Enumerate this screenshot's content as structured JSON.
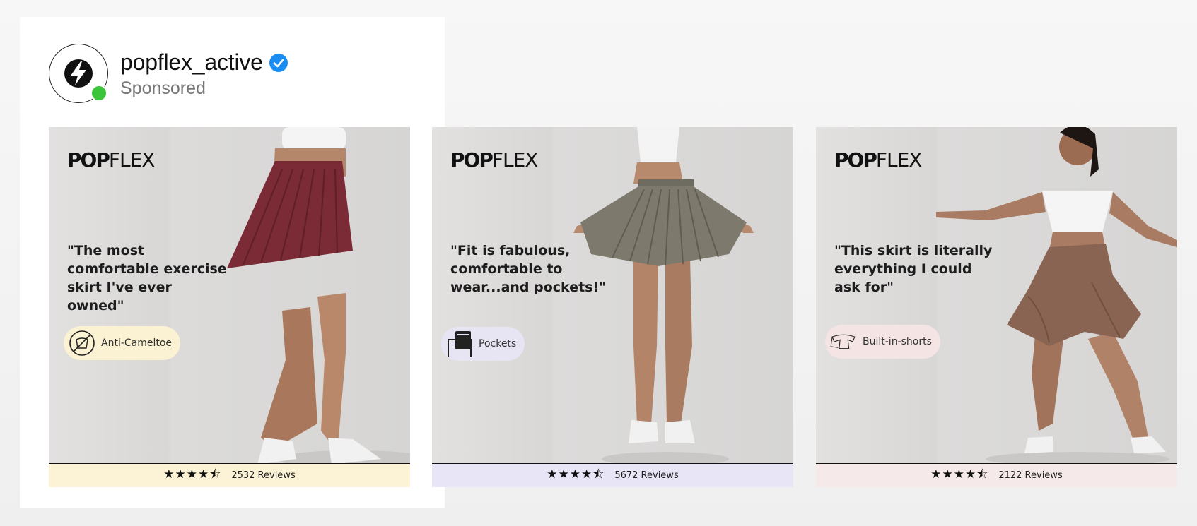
{
  "account": {
    "username": "popflex_active",
    "label": "Sponsored"
  },
  "ads": [
    {
      "logo_bold": "POP",
      "logo_thin": "FLEX",
      "quote": "\"The most comfortable exercise skirt I've ever owned\"",
      "feature": "Anti-Cameltoe",
      "stars": "★★★★⯪",
      "reviews": "2532 Reviews",
      "skirt_color": "#7a2b35"
    },
    {
      "logo_bold": "POP",
      "logo_thin": "FLEX",
      "quote": "\"Fit is fabulous, comfortable to wear...and pockets!\"",
      "feature": "Pockets",
      "stars": "★★★★⯪",
      "reviews": "5672 Reviews",
      "skirt_color": "#7d7a6d"
    },
    {
      "logo_bold": "POP",
      "logo_thin": "FLEX",
      "quote": "\"This skirt is literally everything I could ask for\"",
      "feature": "Built-in-shorts",
      "stars": "★★★★⯪",
      "reviews": "2122 Reviews",
      "skirt_color": "#8a6452"
    }
  ],
  "colors": {
    "verified": "#1b8cf2",
    "online": "#3cc43c",
    "ad1_bar": "#fcf3d6",
    "ad2_bar": "#e8e6f6",
    "ad3_bar": "#f6e9e9"
  }
}
